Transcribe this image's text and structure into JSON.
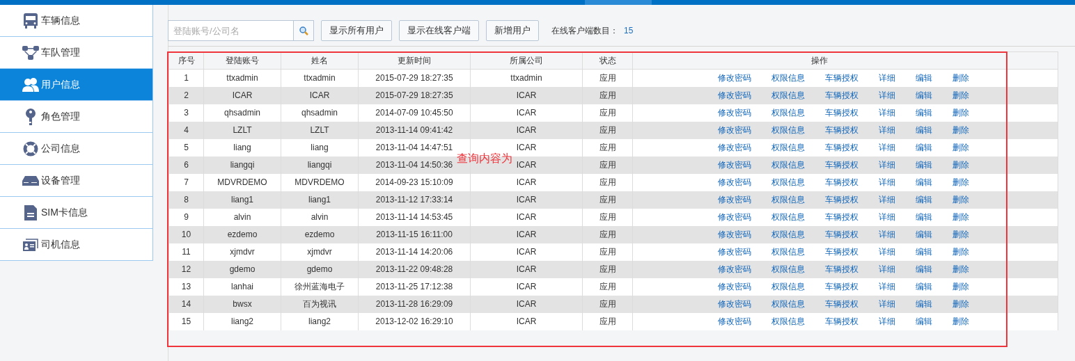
{
  "sidebar": {
    "items": [
      {
        "label": "车辆信息",
        "selected": false
      },
      {
        "label": "车队管理",
        "selected": false
      },
      {
        "label": "用户信息",
        "selected": true
      },
      {
        "label": "角色管理",
        "selected": false
      },
      {
        "label": "公司信息",
        "selected": false
      },
      {
        "label": "设备管理",
        "selected": false
      },
      {
        "label": "SIM卡信息",
        "selected": false
      },
      {
        "label": "司机信息",
        "selected": false
      }
    ]
  },
  "toolbar": {
    "search": {
      "placeholder": "登陆账号/公司名"
    },
    "buttons": [
      "显示所有用户",
      "显示在线客户端",
      "新增用户"
    ],
    "online_label": "在线客户端数目：",
    "online_count": "15"
  },
  "table": {
    "columns": [
      "序号",
      "登陆账号",
      "姓名",
      "更新时间",
      "所属公司",
      "状态",
      "操作"
    ],
    "rows": [
      {
        "cells": [
          "1",
          "ttxadmin",
          "ttxadmin",
          "2015-07-29 18:27:35",
          "ttxadmin",
          "应用"
        ],
        "actions": [
          "修改密码",
          "权限信息",
          "车辆授权",
          "详细",
          "编辑",
          "删除"
        ]
      },
      {
        "cells": [
          "2",
          "ICAR",
          "ICAR",
          "2015-07-29 18:27:35",
          "ICAR",
          "应用"
        ],
        "actions": [
          "修改密码",
          "权限信息",
          "车辆授权",
          "详细",
          "编辑",
          "删除"
        ]
      },
      {
        "cells": [
          "3",
          "qhsadmin",
          "qhsadmin",
          "2014-07-09 10:45:50",
          "ICAR",
          "应用"
        ],
        "actions": [
          "修改密码",
          "权限信息",
          "车辆授权",
          "详细",
          "编辑",
          "删除"
        ]
      },
      {
        "cells": [
          "4",
          "LZLT",
          "LZLT",
          "2013-11-14 09:41:42",
          "ICAR",
          "应用"
        ],
        "actions": [
          "修改密码",
          "权限信息",
          "车辆授权",
          "详细",
          "编辑",
          "删除"
        ]
      },
      {
        "cells": [
          "5",
          "liang",
          "liang",
          "2013-11-04 14:47:51",
          "ICAR",
          "应用"
        ],
        "actions": [
          "修改密码",
          "权限信息",
          "车辆授权",
          "详细",
          "编辑",
          "删除"
        ]
      },
      {
        "cells": [
          "6",
          "liangqi",
          "liangqi",
          "2013-11-04 14:50:36",
          "ICAR",
          "应用"
        ],
        "actions": [
          "修改密码",
          "权限信息",
          "车辆授权",
          "详细",
          "编辑",
          "删除"
        ]
      },
      {
        "cells": [
          "7",
          "MDVRDEMO",
          "MDVRDEMO",
          "2014-09-23 15:10:09",
          "ICAR",
          "应用"
        ],
        "actions": [
          "修改密码",
          "权限信息",
          "车辆授权",
          "详细",
          "编辑",
          "删除"
        ]
      },
      {
        "cells": [
          "8",
          "liang1",
          "liang1",
          "2013-11-12 17:33:14",
          "ICAR",
          "应用"
        ],
        "actions": [
          "修改密码",
          "权限信息",
          "车辆授权",
          "详细",
          "编辑",
          "删除"
        ]
      },
      {
        "cells": [
          "9",
          "alvin",
          "alvin",
          "2013-11-14 14:53:45",
          "ICAR",
          "应用"
        ],
        "actions": [
          "修改密码",
          "权限信息",
          "车辆授权",
          "详细",
          "编辑",
          "删除"
        ]
      },
      {
        "cells": [
          "10",
          "ezdemo",
          "ezdemo",
          "2013-11-15 16:11:00",
          "ICAR",
          "应用"
        ],
        "actions": [
          "修改密码",
          "权限信息",
          "车辆授权",
          "详细",
          "编辑",
          "删除"
        ]
      },
      {
        "cells": [
          "11",
          "xjmdvr",
          "xjmdvr",
          "2013-11-14 14:20:06",
          "ICAR",
          "应用"
        ],
        "actions": [
          "修改密码",
          "权限信息",
          "车辆授权",
          "详细",
          "编辑",
          "删除"
        ]
      },
      {
        "cells": [
          "12",
          "gdemo",
          "gdemo",
          "2013-11-22 09:48:28",
          "ICAR",
          "应用"
        ],
        "actions": [
          "修改密码",
          "权限信息",
          "车辆授权",
          "详细",
          "编辑",
          "删除"
        ]
      },
      {
        "cells": [
          "13",
          "lanhai",
          "徐州蓝海电子",
          "2013-11-25 17:12:38",
          "ICAR",
          "应用"
        ],
        "actions": [
          "修改密码",
          "权限信息",
          "车辆授权",
          "详细",
          "编辑",
          "删除"
        ]
      },
      {
        "cells": [
          "14",
          "bwsx",
          "百为视讯",
          "2013-11-28 16:29:09",
          "ICAR",
          "应用"
        ],
        "actions": [
          "修改密码",
          "权限信息",
          "车辆授权",
          "详细",
          "编辑",
          "删除"
        ]
      },
      {
        "cells": [
          "15",
          "liang2",
          "liang2",
          "2013-12-02 16:29:10",
          "ICAR",
          "应用"
        ],
        "actions": [
          "修改密码",
          "权限信息",
          "车辆授权",
          "详细",
          "编辑",
          "删除"
        ]
      }
    ]
  },
  "annotation": {
    "text": "查询内容为"
  }
}
